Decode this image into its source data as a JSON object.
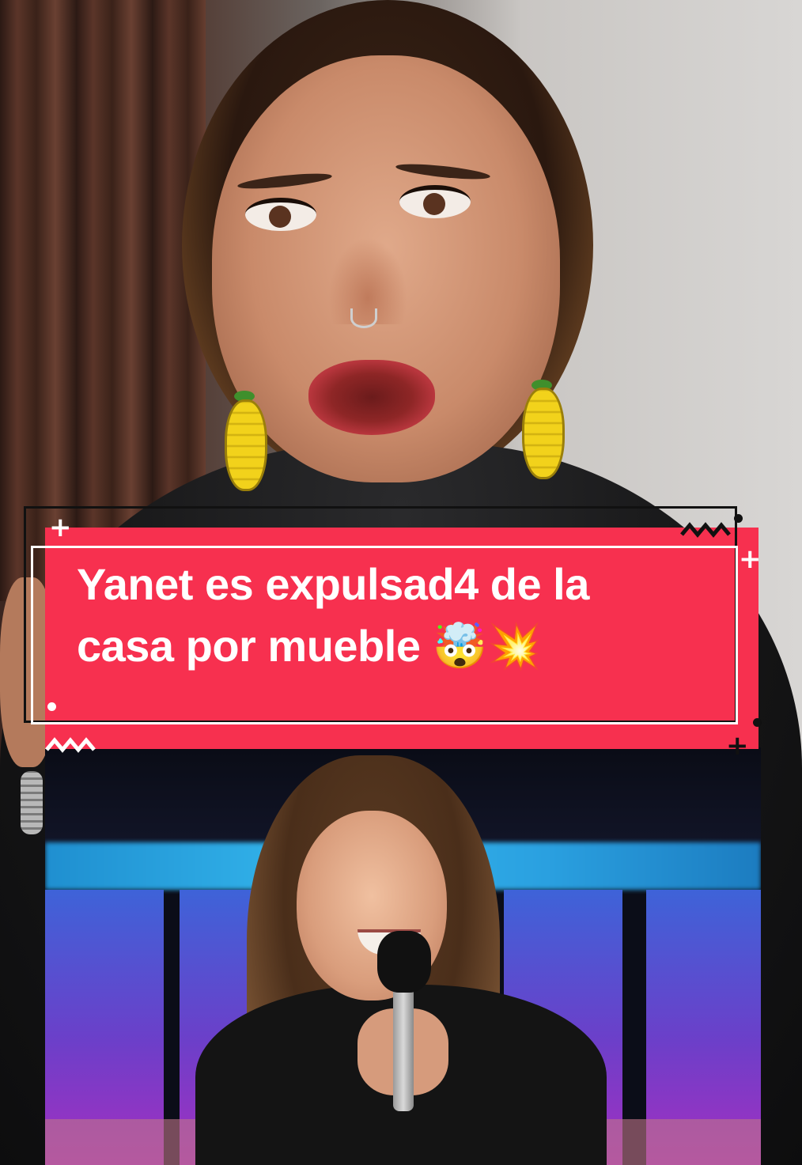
{
  "caption": {
    "line1": "Yanet es expulsad4 de la",
    "line2": "casa por mueble 🤯💥"
  },
  "colors": {
    "caption_background": "#f7304f",
    "caption_text": "#ffffff",
    "frame_dark": "#111111"
  }
}
